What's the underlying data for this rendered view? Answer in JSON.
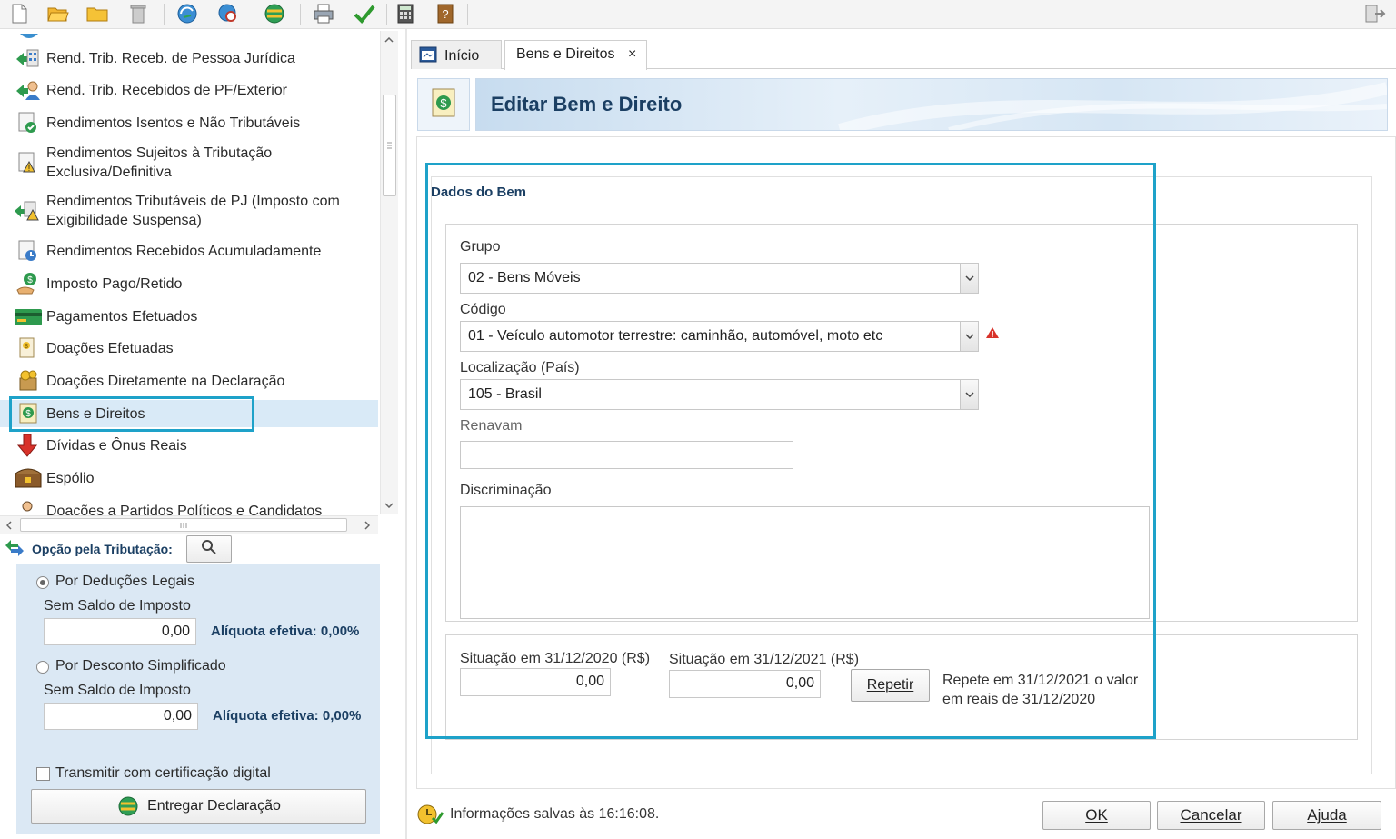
{
  "toolbar": {
    "icons": [
      "new-file-icon",
      "open-folder-icon",
      "folder-icon",
      "trash-icon",
      "refresh-globe-icon",
      "search-globe-icon",
      "transmit-globe-icon",
      "print-icon",
      "check-icon",
      "calculator-icon",
      "help-book-icon",
      "exit-icon"
    ]
  },
  "nav": {
    "items": [
      {
        "label": "Rend. Trib. Receb. de Pessoa Jurídica",
        "icon": "pj-income-icon"
      },
      {
        "label": "Rend. Trib. Recebidos de PF/Exterior",
        "icon": "pf-income-icon"
      },
      {
        "label": "Rendimentos Isentos e Não Tributáveis",
        "icon": "exempt-income-icon"
      },
      {
        "label": "Rendimentos Sujeitos à Tributação",
        "label2": "Exclusiva/Definitiva",
        "icon": "exclusive-tax-icon"
      },
      {
        "label": "Rendimentos Tributáveis de PJ (Imposto com",
        "label2": "Exigibilidade Suspensa)",
        "icon": "suspended-tax-icon"
      },
      {
        "label": "Rendimentos Recebidos Acumuladamente",
        "icon": "accumulated-income-icon"
      },
      {
        "label": "Imposto Pago/Retido",
        "icon": "tax-paid-icon"
      },
      {
        "label": "Pagamentos Efetuados",
        "icon": "payments-card-icon"
      },
      {
        "label": "Doações Efetuadas",
        "icon": "donations-icon"
      },
      {
        "label": "Doações Diretamente na Declaração",
        "icon": "direct-donations-icon"
      },
      {
        "label": "Bens e Direitos",
        "icon": "assets-icon"
      },
      {
        "label": "Dívidas e Ônus Reais",
        "icon": "debts-arrow-icon"
      },
      {
        "label": "Espólio",
        "icon": "estate-chest-icon"
      },
      {
        "label": "Doações a Partidos Políticos e Candidatos",
        "icon": "political-donations-icon"
      }
    ]
  },
  "tax_option": {
    "title": "Opção pela Tributação:",
    "legal": {
      "label": "Por Deduções Legais",
      "status": "Sem Saldo de Imposto",
      "value": "0,00",
      "rate": "Alíquota efetiva: 0,00%"
    },
    "simplified": {
      "label": "Por Desconto Simplificado",
      "status": "Sem Saldo de Imposto",
      "value": "0,00",
      "rate": "Alíquota efetiva: 0,00%"
    },
    "certificate_label": "Transmitir com certificação digital",
    "deliver_button": "Entregar Declaração"
  },
  "tabs": [
    {
      "label": "Início"
    },
    {
      "label": "Bens e Direitos"
    }
  ],
  "tab_close": "×",
  "page": {
    "title": "Editar Bem e Direito"
  },
  "form": {
    "section_title": "Dados do Bem",
    "grupo": {
      "label": "Grupo",
      "value": "02 - Bens Móveis"
    },
    "codigo": {
      "label": "Código",
      "value": "01 - Veículo automotor terrestre: caminhão, automóvel, moto etc"
    },
    "localizacao": {
      "label": "Localização (País)",
      "value": "105 - Brasil"
    },
    "renavam": {
      "label": "Renavam",
      "value": ""
    },
    "discriminacao": {
      "label": "Discriminação",
      "value": ""
    },
    "sit2020": {
      "label": "Situação em 31/12/2020 (R$)",
      "value": "0,00"
    },
    "sit2021": {
      "label": "Situação em 31/12/2021 (R$)",
      "value": "0,00"
    },
    "repeat_button": "Repetir",
    "repeat_hint1": "Repete em 31/12/2021 o valor",
    "repeat_hint2": "em reais de 31/12/2020"
  },
  "status": {
    "text": "Informações salvas às 16:16:08."
  },
  "buttons": {
    "ok": "OK",
    "cancel": "Cancelar",
    "help": "Ajuda"
  },
  "colors": {
    "highlight": "#1ea2c9",
    "title": "#1b3f63",
    "panel": "#dbe8f4",
    "selected_row": "#d9eaf7"
  }
}
